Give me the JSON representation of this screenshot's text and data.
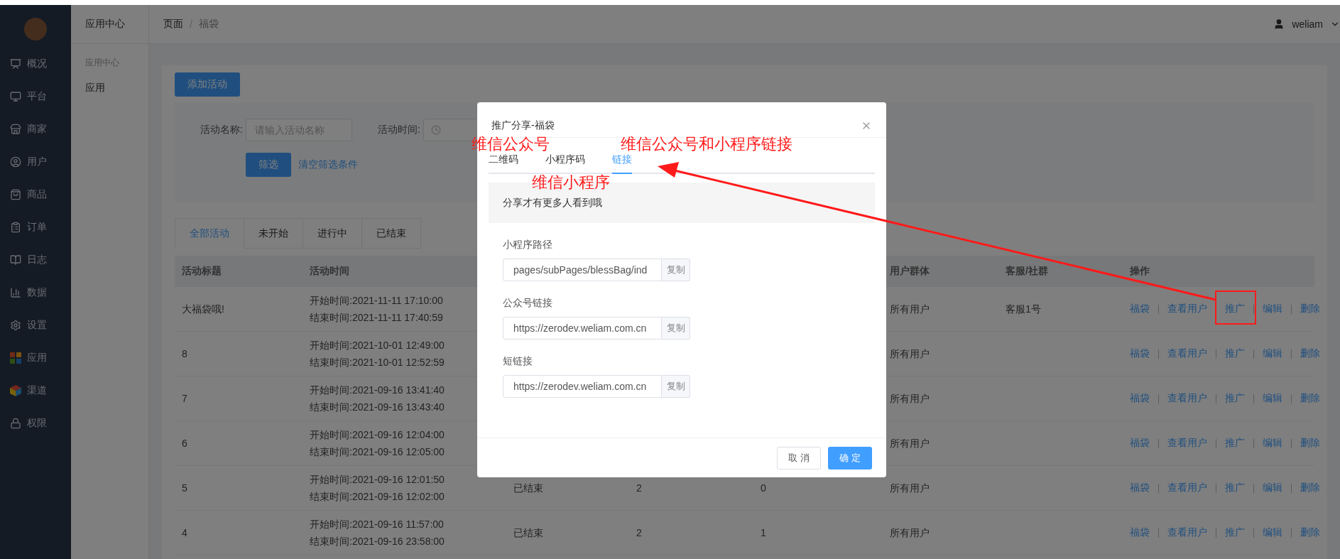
{
  "sidebar": {
    "items": [
      {
        "label": "概况"
      },
      {
        "label": "平台"
      },
      {
        "label": "商家"
      },
      {
        "label": "用户"
      },
      {
        "label": "商品"
      },
      {
        "label": "订单"
      },
      {
        "label": "日志"
      },
      {
        "label": "数据"
      },
      {
        "label": "设置"
      },
      {
        "label": "应用"
      },
      {
        "label": "渠道"
      },
      {
        "label": "权限"
      }
    ]
  },
  "subnav": {
    "title": "应用中心",
    "group": "应用中心",
    "items": [
      {
        "label": "应用"
      }
    ]
  },
  "header": {
    "breadcrumb": [
      "页面",
      "福袋"
    ],
    "separator": "/",
    "user": "weliam"
  },
  "add_button": "添加活动",
  "filter": {
    "fields": [
      {
        "kind": "text",
        "label": "活动名称:",
        "placeholder": "请输入活动名称"
      },
      {
        "kind": "date",
        "label": "活动时间:"
      }
    ],
    "submit": "筛选",
    "clear": "清空筛选条件"
  },
  "tabs": [
    {
      "label": "全部活动",
      "selected": true
    },
    {
      "label": "未开始",
      "selected": false
    },
    {
      "label": "进行中",
      "selected": false
    },
    {
      "label": "已结束",
      "selected": false
    }
  ],
  "table": {
    "columns": {
      "title": "活动标题",
      "time": "活动时间",
      "user_group": "用户群体",
      "service": "客服/社群",
      "actions": "操作"
    },
    "rows": [
      {
        "title": "大福袋哦!",
        "start": "开始时间:2021-11-11 17:10:00",
        "end": "结束时间:2021-11-11 17:40:59",
        "user_group": "所有用户",
        "service": "客服1号",
        "actions": [
          "福袋",
          "查看用户",
          "推广",
          "编辑",
          "删除"
        ]
      },
      {
        "title": "8",
        "start": "开始时间:2021-10-01 12:49:00",
        "end": "结束时间:2021-10-01 12:52:59",
        "user_group": "所有用户",
        "actions": [
          "福袋",
          "查看用户",
          "推广",
          "编辑",
          "删除"
        ]
      },
      {
        "title": "7",
        "start": "开始时间:2021-09-16 13:41:40",
        "end": "结束时间:2021-09-16 13:43:40",
        "user_group": "所有用户",
        "actions": [
          "福袋",
          "查看用户",
          "推广",
          "编辑",
          "删除"
        ]
      },
      {
        "title": "6",
        "start": "开始时间:2021-09-16 12:04:00",
        "end": "结束时间:2021-09-16 12:05:00",
        "user_group": "所有用户",
        "actions": [
          "福袋",
          "查看用户",
          "推广",
          "编辑",
          "删除"
        ]
      },
      {
        "title": "5",
        "start": "开始时间:2021-09-16 12:01:50",
        "end": "结束时间:2021-09-16 12:02:00",
        "column_3": "已结束",
        "column_4": "2",
        "column_5": "0",
        "user_group": "所有用户",
        "actions": [
          "福袋",
          "查看用户",
          "推广",
          "编辑",
          "删除"
        ]
      },
      {
        "title": "4",
        "start": "开始时间:2021-09-16 11:57:00",
        "end": "结束时间:2021-09-16 23:58:00",
        "column_3": "已结束",
        "column_4": "2",
        "column_5": "1",
        "user_group": "所有用户",
        "actions": [
          "福袋",
          "查看用户",
          "推广",
          "编辑",
          "删除"
        ]
      }
    ]
  },
  "modal": {
    "title": "推广分享-福袋",
    "tabs": [
      {
        "label": "二维码",
        "selected": false
      },
      {
        "label": "小程序码",
        "selected": false
      },
      {
        "label": "链接",
        "selected": true
      }
    ],
    "tip": "分享才有更多人看到哦",
    "fields": [
      {
        "label": "小程序路径",
        "value": "pages/subPages/blessBag/ind",
        "button": "复制"
      },
      {
        "label": "公众号链接",
        "value": "https://zerodev.weliam.com.cn",
        "button": "复制"
      },
      {
        "label": "短链接",
        "value": "https://zerodev.weliam.com.cn",
        "button": "复制"
      }
    ],
    "cancel": "取 消",
    "confirm": "确 定"
  },
  "annotations": [
    {
      "text": "维信公众号"
    },
    {
      "text": "维信小程序"
    },
    {
      "text": "维信公众号和小程序链接"
    }
  ]
}
